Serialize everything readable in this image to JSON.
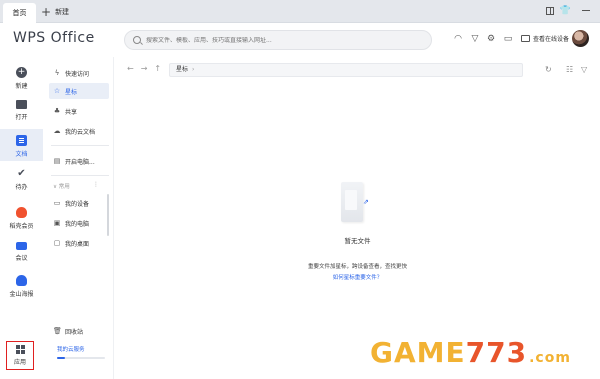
{
  "tabs": {
    "home": "首页",
    "new": "新建"
  },
  "header": {
    "logo": "WPS Office",
    "search_placeholder": "搜索文件、模板、应用、技巧或直接输入网址...",
    "device_label": "查看在线设备"
  },
  "leftnav": {
    "items": [
      {
        "label": "新建",
        "icon": "plus-circle-icon"
      },
      {
        "label": "打开",
        "icon": "folder-icon"
      },
      {
        "label": "文档",
        "icon": "document-icon"
      },
      {
        "label": "待办",
        "icon": "todo-icon"
      },
      {
        "label": "稻壳会员",
        "icon": "vip-icon"
      },
      {
        "label": "会议",
        "icon": "meeting-icon"
      },
      {
        "label": "金山海报",
        "icon": "poster-icon"
      }
    ],
    "apps_label": "应用"
  },
  "subnav": {
    "quick_access": "快速访问",
    "starred": "星标",
    "shared": "共享",
    "my_cloud_docs": "我的云文档",
    "open_email": "开启电脑...",
    "section_common": "常用",
    "my_devices": "我的设备",
    "my_computer": "我的电脑",
    "my_desktop": "我的桌面",
    "recycle_bin": "回收站",
    "cloud_service": "我的云服务"
  },
  "main": {
    "path": "星标",
    "empty_title": "暂无文件",
    "empty_desc": "重要文件加星标，跨设备查看，查找更快",
    "empty_link": "如何星标重要文件？"
  },
  "watermark": {
    "game": "GAME",
    "num": "773",
    "com": ".com"
  },
  "colors": {
    "accent": "#2c65e8",
    "highlight_box": "#e02020"
  }
}
